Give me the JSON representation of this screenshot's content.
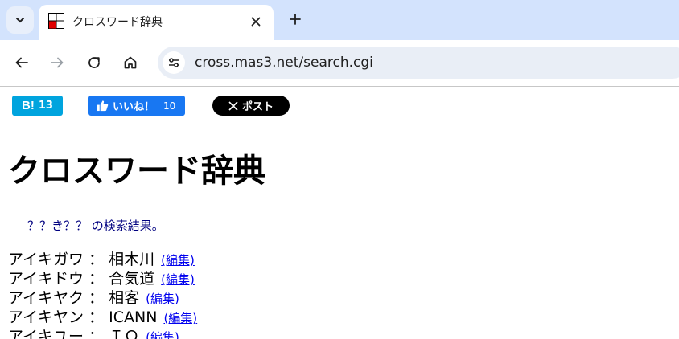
{
  "browser": {
    "tab": {
      "title": "クロスワード辞典"
    },
    "address": {
      "url": "cross.mas3.net/search.cgi"
    }
  },
  "share": {
    "hatena": {
      "logo": "B!",
      "count": "13"
    },
    "like": {
      "label": "いいね！",
      "count": "10"
    },
    "x": {
      "label": "ポスト"
    }
  },
  "page": {
    "title": "クロスワード辞典",
    "search": {
      "query": "？？き？？",
      "suffix": " の検索結果。"
    },
    "results": [
      {
        "reading": "アイキガワ",
        "word": "相木川",
        "edit": "(編集)"
      },
      {
        "reading": "アイキドウ",
        "word": "合気道",
        "edit": "(編集)"
      },
      {
        "reading": "アイキヤク",
        "word": "相客",
        "edit": "(編集)"
      },
      {
        "reading": "アイキヤン",
        "word": "ICANN",
        "edit": "(編集)"
      },
      {
        "reading": "アイキユー",
        "word": "ＩＱ",
        "edit": "(編集)"
      }
    ],
    "separator": " ： "
  },
  "colors": {
    "tabstrip": "#d3e3fd",
    "hatena": "#00a4de",
    "facebook": "#1877f2",
    "x": "#000000",
    "summary": "#000080",
    "link": "#0000ee"
  }
}
